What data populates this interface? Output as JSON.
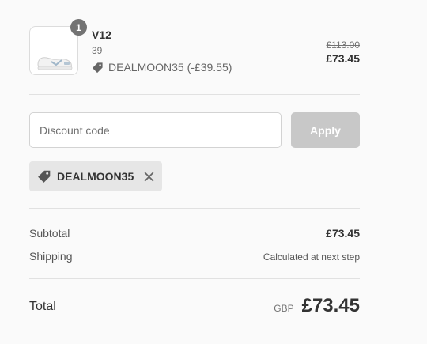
{
  "line_item": {
    "quantity": "1",
    "name": "V12",
    "variant": "39",
    "discount_text": "DEALMOON35 (-£39.55)",
    "original_price": "£113.00",
    "price": "£73.45"
  },
  "discount_form": {
    "placeholder": "Discount code",
    "value": "",
    "apply_label": "Apply"
  },
  "applied_discount": {
    "code": "DEALMOON35"
  },
  "summary": {
    "subtotal_label": "Subtotal",
    "subtotal_value": "£73.45",
    "shipping_label": "Shipping",
    "shipping_value": "Calculated at next step",
    "total_label": "Total",
    "currency": "GBP",
    "total_value": "£73.45"
  },
  "colors": {
    "badge": "#737373",
    "apply_disabled": "#c8c8c8",
    "chip_bg": "#e6e6e6",
    "page_bg": "#fafafa"
  },
  "icons": [
    "sneaker-product-image",
    "tag-icon",
    "close-icon"
  ]
}
